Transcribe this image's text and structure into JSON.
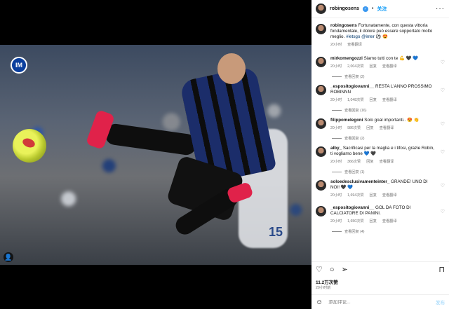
{
  "post": {
    "username": "robingosens",
    "follow_label": "关注",
    "caption_user": "robingosens",
    "caption_text": "Fortunatamente, con questa vittoria fondamentale, il dolore può essere sopportato molto meglio.",
    "caption_tags": "#letsgo @inter ⚽ 😍",
    "caption_time": "20小时",
    "caption_action": "查看翻译",
    "likes": "11.2万次赞",
    "posted_ago": "20小时前",
    "comment_placeholder": "添加评论...",
    "post_label": "发布"
  },
  "photo": {
    "badge_text": "IM",
    "background_number": "15"
  },
  "labels": {
    "reply": "回复",
    "translate": "查看翻译"
  },
  "comments": [
    {
      "user": "mirkomengozzi",
      "text": "Siamo tutti con te 💪 🖤 💙",
      "time": "20小时",
      "likes": "2,004次赞",
      "replies": "查看回复 (2)"
    },
    {
      "user": "_espositogiovanni__",
      "text": "RESTA L'ANNO PROSSIMO ROBINNN",
      "time": "20小时",
      "likes": "1,048次赞",
      "replies": "查看回复 (16)"
    },
    {
      "user": "filippomelegoni",
      "text": "Solo goal importanti.. 😍 👏",
      "time": "20小时",
      "likes": "986次赞",
      "replies": "查看回复 (2)"
    },
    {
      "user": "alby_",
      "text": "Sacrificasi per la maglia e i tifosi, grazie Robin, ti vogliamo bene 💙 🖤",
      "time": "20小时",
      "likes": "366次赞",
      "replies": "查看回复 (1)"
    },
    {
      "user": "soloedesclusivamenteinter_",
      "text": "GRANDE! UNO DI NOI! 🖤 💙",
      "time": "20小时",
      "likes": "1,694次赞",
      "replies": ""
    },
    {
      "user": "_espositogiovanni__",
      "text": "GOL DA FOTO DI CALCIATORE DI PANINI.",
      "time": "20小时",
      "likes": "1,650次赞",
      "replies": "查看回复 (4)"
    }
  ]
}
